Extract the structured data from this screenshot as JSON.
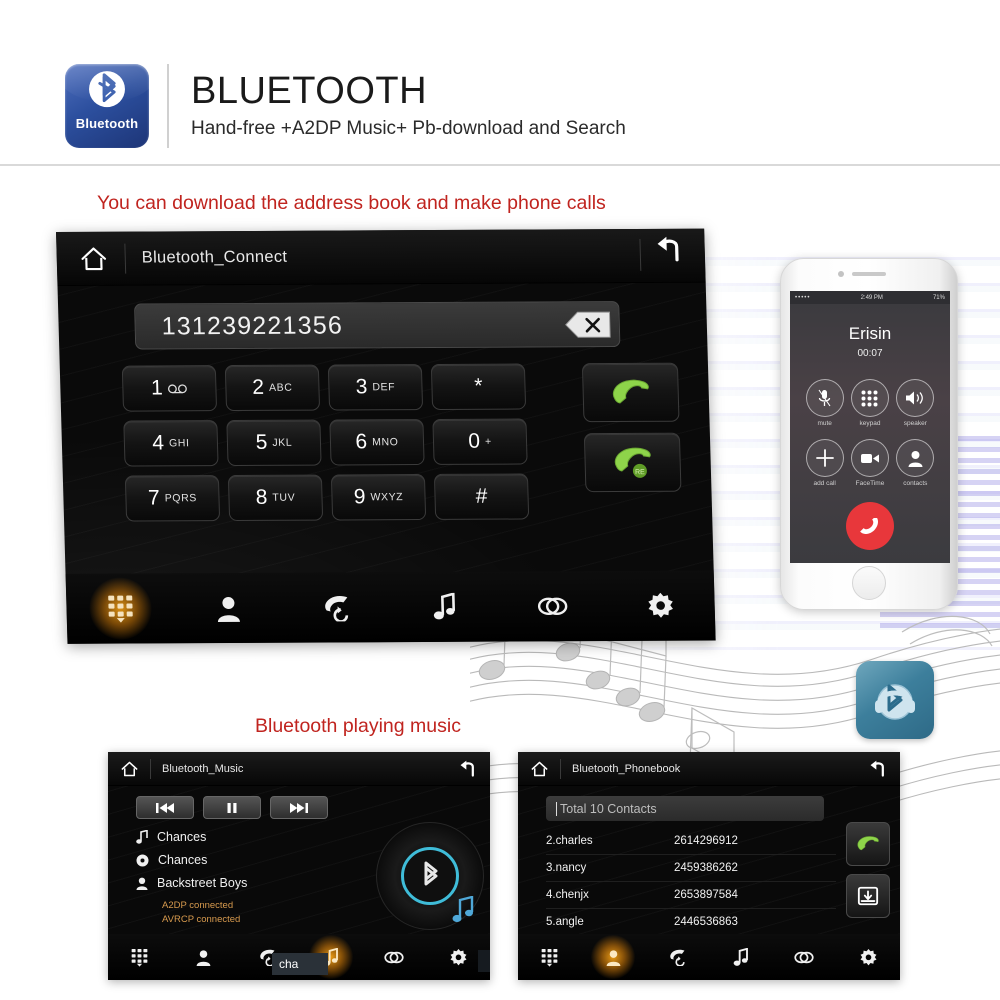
{
  "header": {
    "logo_word": "Bluetooth",
    "logo_icon": "bluetooth-icon",
    "title": "BLUETOOTH",
    "subtitle": "Hand-free +A2DP Music+ Pb-download and Search"
  },
  "captions": {
    "main": "You can download the address book and make phone calls",
    "music": "Bluetooth playing music",
    "color": "#c0241f"
  },
  "main_unit": {
    "home_icon": "home-icon",
    "title": "Bluetooth_Connect",
    "back_icon": "back-arrow-icon",
    "number_field": {
      "value": "131239221356",
      "backspace_icon": "backspace-icon"
    },
    "keys": [
      [
        {
          "digit": "1",
          "letters": "☀☀",
          "name": "key-1"
        },
        {
          "digit": "2",
          "letters": "ABC",
          "name": "key-2"
        },
        {
          "digit": "3",
          "letters": "DEF",
          "name": "key-3"
        },
        {
          "digit": "*",
          "letters": "",
          "name": "key-star"
        }
      ],
      [
        {
          "digit": "4",
          "letters": "GHI",
          "name": "key-4"
        },
        {
          "digit": "5",
          "letters": "JKL",
          "name": "key-5"
        },
        {
          "digit": "6",
          "letters": "MNO",
          "name": "key-6"
        },
        {
          "digit": "0",
          "letters": "+",
          "name": "key-0"
        }
      ],
      [
        {
          "digit": "7",
          "letters": "PQRS",
          "name": "key-7"
        },
        {
          "digit": "8",
          "letters": "TUV",
          "name": "key-8"
        },
        {
          "digit": "9",
          "letters": "WXYZ",
          "name": "key-9"
        },
        {
          "digit": "#",
          "letters": "",
          "name": "key-hash"
        }
      ]
    ],
    "call_button_icon": "green-handset-icon",
    "redial_button_icon": "green-handset-redial-icon",
    "redial_badge": "RE",
    "nav": [
      {
        "name": "nav-keypad",
        "icon": "keypad-icon",
        "active": true
      },
      {
        "name": "nav-contacts",
        "icon": "contact-person-icon",
        "active": false
      },
      {
        "name": "nav-call-log",
        "icon": "call-history-icon",
        "active": false
      },
      {
        "name": "nav-music",
        "icon": "music-note-icon",
        "active": false
      },
      {
        "name": "nav-link",
        "icon": "link-chain-icon",
        "active": false
      },
      {
        "name": "nav-settings",
        "icon": "gear-icon",
        "active": false
      }
    ],
    "accent_active": "#ffa817"
  },
  "phone": {
    "status": {
      "signal": "•••••",
      "wifi_icon": "wifi-icon",
      "time": "2:49 PM",
      "battery_percent": "71%",
      "battery_icon": "battery-icon"
    },
    "caller_name": "Erisin",
    "call_timer": "00:07",
    "buttons": [
      {
        "label": "mute",
        "icon": "mute-microphone-icon",
        "name": "phone-mute-button"
      },
      {
        "label": "keypad",
        "icon": "keypad-icon",
        "name": "phone-keypad-button"
      },
      {
        "label": "speaker",
        "icon": "speaker-icon",
        "name": "phone-speaker-button"
      },
      {
        "label": "add call",
        "icon": "plus-icon",
        "name": "phone-add-call-button"
      },
      {
        "label": "FaceTime",
        "icon": "video-camera-icon",
        "name": "phone-facetime-button"
      },
      {
        "label": "contacts",
        "icon": "contact-person-icon",
        "name": "phone-contacts-button"
      }
    ],
    "end_call_icon": "end-call-icon",
    "end_call_color": "#e8373b"
  },
  "bt_badge": {
    "icon": "bluetooth-headphone-icon",
    "color": "#3d7f9c"
  },
  "music_unit": {
    "home_icon": "home-icon",
    "title": "Bluetooth_Music",
    "back_icon": "back-arrow-icon",
    "controls": [
      {
        "name": "previous-track-button",
        "icon": "previous-icon",
        "glyph": "⏮"
      },
      {
        "name": "pause-button",
        "icon": "pause-icon",
        "glyph": "⏸"
      },
      {
        "name": "next-track-button",
        "icon": "next-icon",
        "glyph": "⏭"
      }
    ],
    "meta": [
      {
        "icon": "music-note-icon",
        "text": "Chances",
        "name": "track-title"
      },
      {
        "icon": "album-disc-icon",
        "text": "Chances",
        "name": "album-name"
      },
      {
        "icon": "artist-person-icon",
        "text": "Backstreet Boys",
        "name": "artist-name"
      }
    ],
    "status_lines": [
      "A2DP connected",
      "AVRCP connected"
    ],
    "status_color": "#d79a4e",
    "vinyl_icon": "bluetooth-vinyl-icon",
    "tooltip": "cha",
    "nav": [
      {
        "name": "nav-keypad",
        "icon": "keypad-icon",
        "active": false
      },
      {
        "name": "nav-contacts",
        "icon": "contact-person-icon",
        "active": false
      },
      {
        "name": "nav-call-log",
        "icon": "call-history-icon",
        "active": false
      },
      {
        "name": "nav-music",
        "icon": "music-note-icon",
        "active": true
      },
      {
        "name": "nav-link",
        "icon": "link-chain-icon",
        "active": false
      },
      {
        "name": "nav-settings",
        "icon": "gear-icon",
        "active": false
      }
    ]
  },
  "phonebook_unit": {
    "home_icon": "home-icon",
    "title": "Bluetooth_Phonebook",
    "back_icon": "back-arrow-icon",
    "search_value": "Total 10 Contacts",
    "contacts": [
      {
        "name": "2.charles",
        "number": "2614296912"
      },
      {
        "name": "3.nancy",
        "number": "2459386262"
      },
      {
        "name": "4.chenjx",
        "number": "2653897584"
      },
      {
        "name": "5.angle",
        "number": "2446536863"
      }
    ],
    "side_buttons": [
      {
        "name": "call-contact-button",
        "icon": "green-handset-icon"
      },
      {
        "name": "download-phonebook-button",
        "icon": "download-inbox-icon"
      }
    ],
    "nav": [
      {
        "name": "nav-keypad",
        "icon": "keypad-icon",
        "active": false
      },
      {
        "name": "nav-contacts",
        "icon": "contact-person-icon",
        "active": true
      },
      {
        "name": "nav-call-log",
        "icon": "call-history-icon",
        "active": false
      },
      {
        "name": "nav-music",
        "icon": "music-note-icon",
        "active": false
      },
      {
        "name": "nav-link",
        "icon": "link-chain-icon",
        "active": false
      },
      {
        "name": "nav-settings",
        "icon": "gear-icon",
        "active": false
      }
    ]
  }
}
